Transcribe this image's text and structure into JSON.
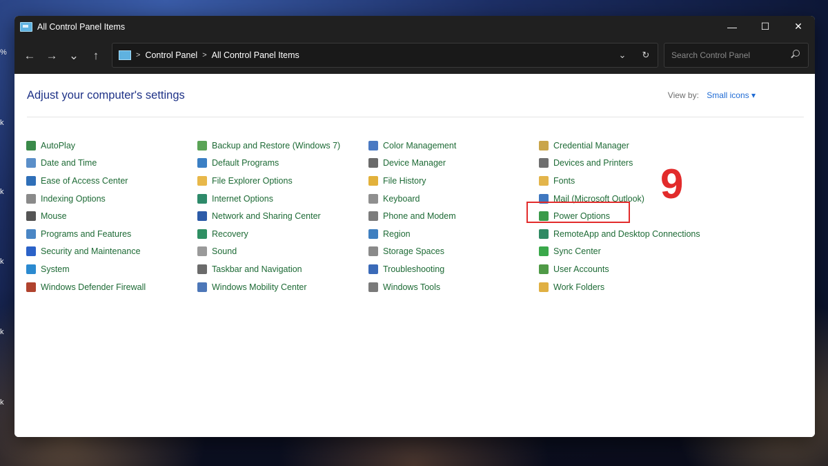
{
  "window": {
    "title": "All Control Panel Items",
    "controls": {
      "minimize": "—",
      "maximize": "☐",
      "close": "✕"
    }
  },
  "nav": {
    "back": "←",
    "forward": "→",
    "recent": "⌄",
    "up": "↑"
  },
  "address": {
    "crumbs": [
      "Control Panel",
      "All Control Panel Items"
    ],
    "dropdown": "⌄",
    "refresh": "↻"
  },
  "search": {
    "placeholder": "Search Control Panel"
  },
  "page": {
    "title": "Adjust your computer's settings",
    "view_by_label": "View by:",
    "view_by_value": "Small icons ▾"
  },
  "items": {
    "col1": [
      {
        "label": "AutoPlay",
        "icon": "autoplay-icon",
        "color": "#3a8a4a"
      },
      {
        "label": "Date and Time",
        "icon": "clock-icon",
        "color": "#5b8fc9"
      },
      {
        "label": "Ease of Access Center",
        "icon": "accessibility-icon",
        "color": "#2f6fb8"
      },
      {
        "label": "Indexing Options",
        "icon": "search-index-icon",
        "color": "#8a8a8a"
      },
      {
        "label": "Mouse",
        "icon": "mouse-icon",
        "color": "#555555"
      },
      {
        "label": "Programs and Features",
        "icon": "programs-icon",
        "color": "#4a86c5"
      },
      {
        "label": "Security and Maintenance",
        "icon": "flag-icon",
        "color": "#2b62c8"
      },
      {
        "label": "System",
        "icon": "monitor-icon",
        "color": "#2b8ad0"
      },
      {
        "label": "Windows Defender Firewall",
        "icon": "firewall-icon",
        "color": "#b0432e"
      }
    ],
    "col2": [
      {
        "label": "Backup and Restore (Windows 7)",
        "icon": "backup-icon",
        "color": "#5aa356"
      },
      {
        "label": "Default Programs",
        "icon": "default-programs-icon",
        "color": "#3b7fc4"
      },
      {
        "label": "File Explorer Options",
        "icon": "folder-options-icon",
        "color": "#e8b84a"
      },
      {
        "label": "Internet Options",
        "icon": "globe-icon",
        "color": "#2e8a6a"
      },
      {
        "label": "Network and Sharing Center",
        "icon": "network-icon",
        "color": "#2c5ba8"
      },
      {
        "label": "Recovery",
        "icon": "recovery-icon",
        "color": "#2f8f63"
      },
      {
        "label": "Sound",
        "icon": "speaker-icon",
        "color": "#9a9a9a"
      },
      {
        "label": "Taskbar and Navigation",
        "icon": "taskbar-icon",
        "color": "#6b6b6b"
      },
      {
        "label": "Windows Mobility Center",
        "icon": "mobility-icon",
        "color": "#4d77b8"
      }
    ],
    "col3": [
      {
        "label": "Color Management",
        "icon": "color-management-icon",
        "color": "#4a79c2"
      },
      {
        "label": "Device Manager",
        "icon": "device-manager-icon",
        "color": "#6a6a6a"
      },
      {
        "label": "File History",
        "icon": "file-history-icon",
        "color": "#e2b13b"
      },
      {
        "label": "Keyboard",
        "icon": "keyboard-icon",
        "color": "#8f8f8f"
      },
      {
        "label": "Phone and Modem",
        "icon": "phone-icon",
        "color": "#7c7c7c"
      },
      {
        "label": "Region",
        "icon": "region-icon",
        "color": "#3f7fc0"
      },
      {
        "label": "Storage Spaces",
        "icon": "storage-icon",
        "color": "#8a8a8a"
      },
      {
        "label": "Troubleshooting",
        "icon": "troubleshoot-icon",
        "color": "#3a6ab8"
      },
      {
        "label": "Windows Tools",
        "icon": "tools-icon",
        "color": "#7a7a7a"
      }
    ],
    "col4": [
      {
        "label": "Credential Manager",
        "icon": "credential-icon",
        "color": "#c9a54a"
      },
      {
        "label": "Devices and Printers",
        "icon": "printer-icon",
        "color": "#6f6f6f"
      },
      {
        "label": "Fonts",
        "icon": "fonts-icon",
        "color": "#e3b54b"
      },
      {
        "label": "Mail (Microsoft Outlook)",
        "icon": "mail-icon",
        "color": "#3f78c0"
      },
      {
        "label": "Power Options",
        "icon": "power-icon",
        "color": "#3a9a4a"
      },
      {
        "label": "RemoteApp and Desktop Connections",
        "icon": "remoteapp-icon",
        "color": "#2f8a63"
      },
      {
        "label": "Sync Center",
        "icon": "sync-icon",
        "color": "#3aa84a"
      },
      {
        "label": "User Accounts",
        "icon": "users-icon",
        "color": "#4f9a46"
      },
      {
        "label": "Work Folders",
        "icon": "work-folders-icon",
        "color": "#e0b043"
      }
    ]
  },
  "annotation": {
    "number": "9"
  },
  "desktop": {
    "edge_chars": [
      "%",
      "k",
      "k",
      "k",
      "k",
      "k"
    ]
  }
}
